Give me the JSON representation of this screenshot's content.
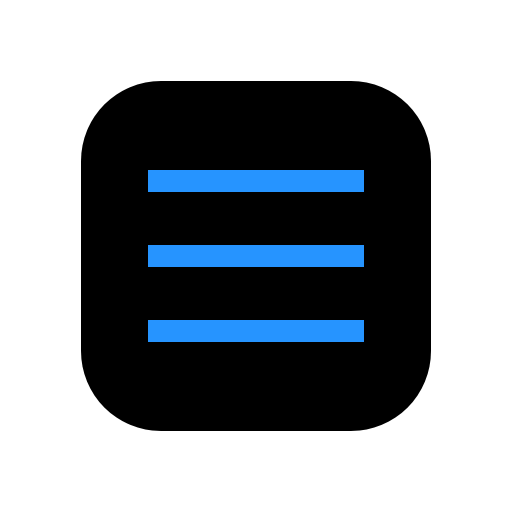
{
  "app_icon": {
    "icon": "hamburger-menu-icon",
    "tile_color": "#000000",
    "bar_color": "#2694FF",
    "background_color": "#FFFFFF",
    "bar_count": 3
  }
}
